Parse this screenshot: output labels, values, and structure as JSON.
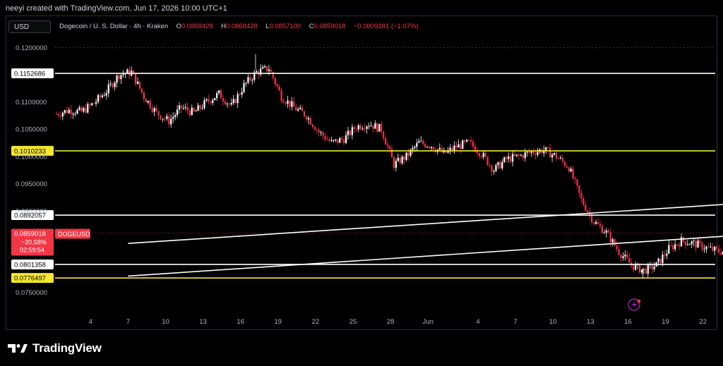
{
  "header": {
    "credit": "neeyi created with TradingView.com, Jun 17, 2026 10:00 UTC+1"
  },
  "toolbar": {
    "currency": "USD"
  },
  "legend": {
    "symbol": "Dogecoin / U. S. Dollar · 4h · Kraken",
    "o_label": "O",
    "o_value": "0.0868428",
    "h_label": "H",
    "h_value": "0.0868428",
    "l_label": "L",
    "l_value": "0.0857100",
    "c_label": "C",
    "c_value": "0.0859018",
    "change": "−0.0009281 (−1.07%)"
  },
  "price_tag": {
    "price": "0.0859018",
    "change_pct": "−20.58%",
    "countdown": "02:59:54",
    "ticker": "DOGEUSD",
    "color": "#f23645"
  },
  "brand": {
    "name": "TradingView"
  },
  "colors": {
    "up": "#ffffff",
    "down": "#f23645",
    "yellow_level": "#f5e72c",
    "white_level": "#ffffff"
  },
  "chart_data": {
    "type": "candlestick",
    "interval": "4h",
    "y_ticks": [
      "0.1200000",
      "0.1100000",
      "0.1050000",
      "0.1000000",
      "0.0950000",
      "0.0900000",
      "0.0750000"
    ],
    "ylim": [
      0.073,
      0.1215
    ],
    "x_ticks": [
      "4",
      "7",
      "10",
      "13",
      "16",
      "19",
      "22",
      "25",
      "28",
      "Jun",
      "4",
      "7",
      "10",
      "13",
      "16",
      "19",
      "22"
    ],
    "horizontal_levels": [
      {
        "value": 0.1152686,
        "label": "0.1152686",
        "color": "white"
      },
      {
        "value": 0.1010233,
        "label": "0.1010233",
        "color": "yellow"
      },
      {
        "value": 0.0892057,
        "label": "0.0892057",
        "color": "white"
      },
      {
        "value": 0.0801358,
        "label": "0.0801358",
        "color": "white"
      },
      {
        "value": 0.0776497,
        "label": "0.0776497",
        "color": "yellow"
      }
    ],
    "last_price": 0.0859018,
    "channel": {
      "lower": {
        "from": {
          "day": 7,
          "price": 0.078
        },
        "to": {
          "day": 73.5,
          "price": 0.0882
        }
      },
      "upper": {
        "from": {
          "day": 7,
          "price": 0.084
        },
        "to": {
          "day": 73.5,
          "price": 0.094
        }
      }
    },
    "path_anchors": [
      [
        0,
        0.1078
      ],
      [
        1,
        0.1085
      ],
      [
        2,
        0.1082
      ],
      [
        3,
        0.1098
      ],
      [
        4,
        0.112
      ],
      [
        5,
        0.115
      ],
      [
        6,
        0.1155
      ],
      [
        7,
        0.111
      ],
      [
        8,
        0.108
      ],
      [
        9,
        0.1065
      ],
      [
        10,
        0.109
      ],
      [
        11,
        0.108
      ],
      [
        12,
        0.11
      ],
      [
        13,
        0.1115
      ],
      [
        14,
        0.1092
      ],
      [
        15,
        0.113
      ],
      [
        16,
        0.1155
      ],
      [
        17,
        0.1162
      ],
      [
        18,
        0.111
      ],
      [
        19,
        0.109
      ],
      [
        20,
        0.1075
      ],
      [
        21,
        0.1045
      ],
      [
        22,
        0.1025
      ],
      [
        23,
        0.1032
      ],
      [
        24,
        0.1055
      ],
      [
        25,
        0.106
      ],
      [
        26,
        0.105
      ],
      [
        27,
        0.0985
      ],
      [
        28,
        0.1
      ],
      [
        29,
        0.1025
      ],
      [
        30,
        0.102
      ],
      [
        31,
        0.1005
      ],
      [
        32,
        0.1018
      ],
      [
        33,
        0.1025
      ],
      [
        34,
        0.1005
      ],
      [
        35,
        0.0975
      ],
      [
        36,
        0.0995
      ],
      [
        37,
        0.1
      ],
      [
        38,
        0.1008
      ],
      [
        39,
        0.1012
      ],
      [
        40,
        0.1
      ],
      [
        41,
        0.098
      ],
      [
        42,
        0.092
      ],
      [
        43,
        0.088
      ],
      [
        44,
        0.086
      ],
      [
        45,
        0.0825
      ],
      [
        46,
        0.08
      ],
      [
        47,
        0.079
      ],
      [
        48,
        0.08
      ],
      [
        49,
        0.083
      ],
      [
        50,
        0.0845
      ],
      [
        51,
        0.084
      ],
      [
        52,
        0.0832
      ],
      [
        53,
        0.0825
      ],
      [
        54,
        0.0828
      ],
      [
        55,
        0.0838
      ],
      [
        56,
        0.0848
      ],
      [
        57,
        0.0865
      ],
      [
        58,
        0.0858
      ],
      [
        59,
        0.085
      ],
      [
        60,
        0.0857
      ],
      [
        61,
        0.0875
      ],
      [
        62,
        0.0868
      ],
      [
        63,
        0.086
      ],
      [
        63.6,
        0.0859
      ]
    ]
  }
}
